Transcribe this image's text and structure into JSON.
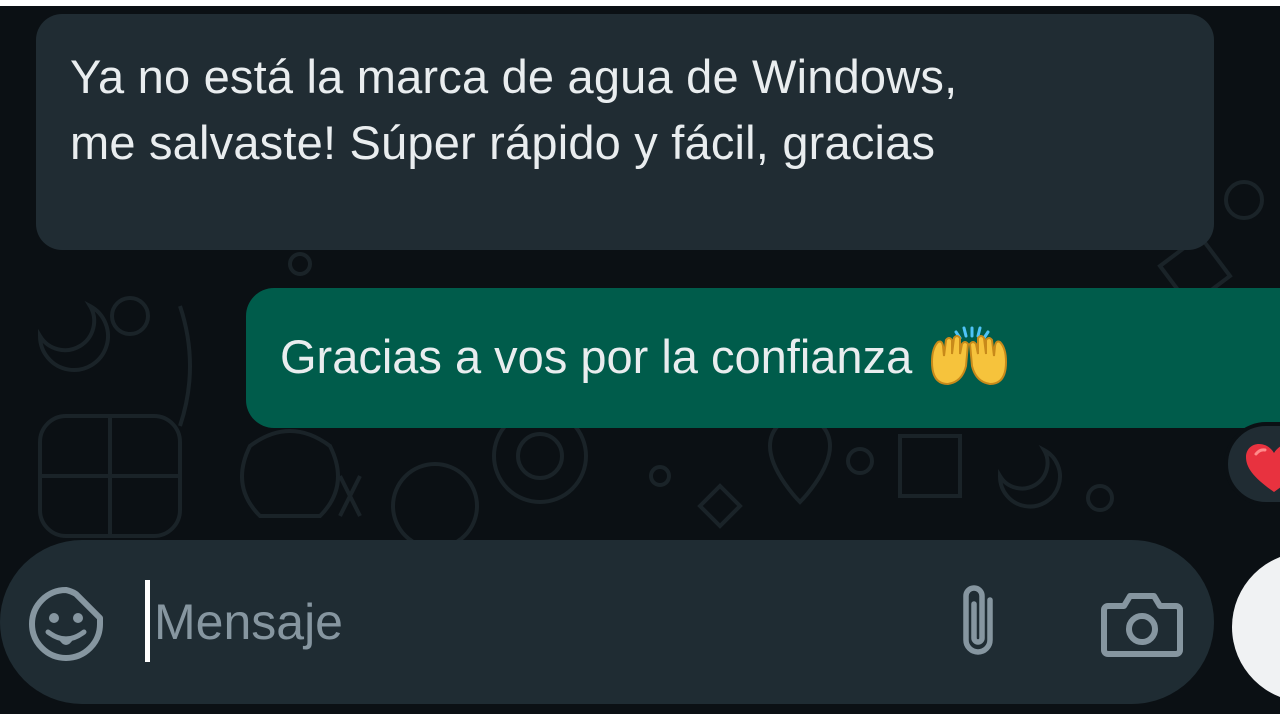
{
  "messages": [
    {
      "direction": "incoming",
      "text": "Ya no está la marca de agua de Windows,\nme salvaste! Súper rápido y fácil, gracias"
    },
    {
      "direction": "outgoing",
      "text": "Gracias a vos por la confianza",
      "emoji": "raising-hands",
      "reaction": "red-heart"
    }
  ],
  "composer": {
    "placeholder": "Mensaje",
    "value": "",
    "icons": [
      "emoji-sticker-icon",
      "paperclip-icon",
      "camera-icon"
    ]
  },
  "colors": {
    "background": "#0b1014",
    "incoming_bubble": "#202c33",
    "outgoing_bubble": "#005c4b",
    "composer": "#1f2c33",
    "text": "#e9edef",
    "icon": "#8696a0",
    "heart": "#e8323f"
  }
}
